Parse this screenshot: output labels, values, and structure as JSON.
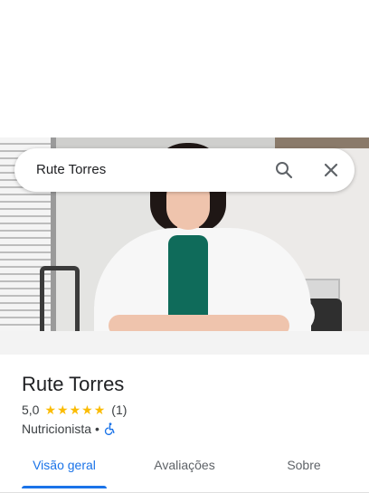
{
  "search": {
    "query": "Rute Torres",
    "search_icon": "search-icon",
    "close_icon": "close-icon"
  },
  "place": {
    "name": "Rute Torres",
    "rating": "5,0",
    "stars": 5,
    "review_count": "(1)",
    "category": "Nutricionista",
    "separator": "•",
    "accessibility_icon": "wheelchair-icon"
  },
  "tabs": [
    {
      "label": "Visão geral",
      "active": true
    },
    {
      "label": "Avaliações",
      "active": false
    },
    {
      "label": "Sobre",
      "active": false
    }
  ],
  "colors": {
    "accent": "#1a73e8",
    "star": "#fbbc04",
    "text": "#202124",
    "secondary_text": "#3c4043"
  }
}
